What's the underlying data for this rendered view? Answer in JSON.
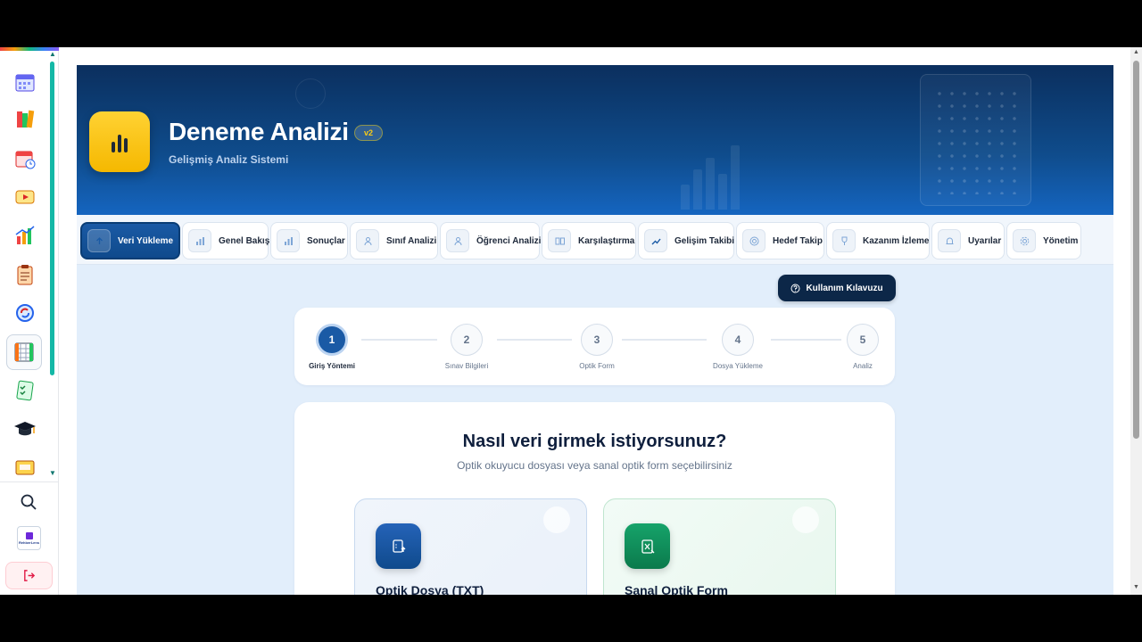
{
  "app": {
    "title": "Deneme Analizi",
    "version_badge": "v2",
    "subtitle": "Gelişmiş Analiz Sistemi"
  },
  "tabs": [
    {
      "label": "Veri Yükleme",
      "icon": "upload-icon",
      "active": true
    },
    {
      "label": "Genel Bakış",
      "icon": "bar-chart-icon"
    },
    {
      "label": "Sonuçlar",
      "icon": "bar-chart-icon"
    },
    {
      "label": "Sınıf Analizi",
      "icon": "users-icon"
    },
    {
      "label": "Öğrenci Analizi",
      "icon": "user-icon"
    },
    {
      "label": "Karşılaştırma",
      "icon": "compare-icon"
    },
    {
      "label": "Gelişim Takibi",
      "icon": "trend-up-icon"
    },
    {
      "label": "Hedef Takip",
      "icon": "target-icon"
    },
    {
      "label": "Kazanım İzleme",
      "icon": "trophy-icon"
    },
    {
      "label": "Uyarılar",
      "icon": "bell-icon"
    },
    {
      "label": "Yönetim",
      "icon": "gear-icon"
    }
  ],
  "guide_button": {
    "label": "Kullanım Kılavuzu",
    "icon": "help-circle-icon"
  },
  "steps": [
    {
      "number": "1",
      "label": "Giriş Yöntemi",
      "active": true
    },
    {
      "number": "2",
      "label": "Sınav Bilgileri"
    },
    {
      "number": "3",
      "label": "Optik Form"
    },
    {
      "number": "4",
      "label": "Dosya Yükleme"
    },
    {
      "number": "5",
      "label": "Analiz"
    }
  ],
  "method_card": {
    "title": "Nasıl veri girmek istiyorsunuz?",
    "subtitle": "Optik okuyucu dosyası veya sanal optik form seçebilirsiniz",
    "options": [
      {
        "title": "Optik Dosya (TXT)",
        "icon": "file-upload-icon",
        "accent": "#1a5aa5"
      },
      {
        "title": "Sanal Optik Form",
        "icon": "form-edit-icon",
        "accent": "#119560"
      }
    ]
  },
  "sidebar": {
    "icons": [
      "calendar-icon",
      "books-icon",
      "calendar-clock-icon",
      "video-icon",
      "chart-bars-icon",
      "clipboard-icon",
      "refresh-icon",
      "grid-report-icon",
      "checklist-icon",
      "graduation-cap-icon",
      "folder-icon"
    ],
    "logo_text": "RehberLens",
    "search_icon": "search-icon",
    "logout_icon": "logout-icon"
  },
  "colors": {
    "brand_dark": "#0b2f5e",
    "brand": "#1a5aa5",
    "accent_yellow": "#ffd233",
    "success": "#119560",
    "teal_scroll": "#14b8a6"
  }
}
